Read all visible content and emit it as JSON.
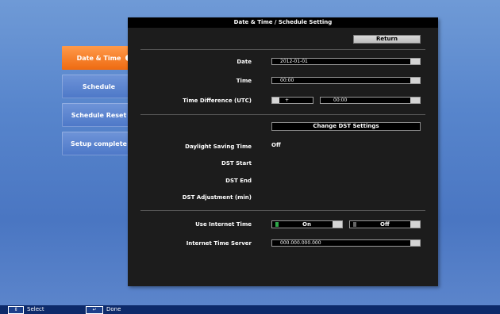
{
  "panel": {
    "title": "Date & Time / Schedule Setting",
    "return_label": "Return"
  },
  "sidebar": {
    "items": [
      {
        "label": "Date & Time"
      },
      {
        "label": "Schedule"
      },
      {
        "label": "Schedule Reset"
      },
      {
        "label": "Setup complete"
      }
    ]
  },
  "fields": {
    "date_label": "Date",
    "date_value": "2012-01-01",
    "time_label": "Time",
    "time_value": "00:00",
    "tz_label": "Time Difference (UTC)",
    "tz_sign": "+",
    "tz_value": "00:00",
    "change_dst_label": "Change DST Settings",
    "dst_label": "Daylight Saving Time",
    "dst_value": "Off",
    "dst_start_label": "DST Start",
    "dst_end_label": "DST End",
    "dst_adjust_label": "DST Adjustment (min)",
    "internet_time_label": "Use Internet Time",
    "on_label": "On",
    "off_label": "Off",
    "server_label": "Internet Time Server",
    "server_value": "000.000.000.000"
  },
  "footer": {
    "select_label": "Select",
    "done_label": "Done"
  }
}
